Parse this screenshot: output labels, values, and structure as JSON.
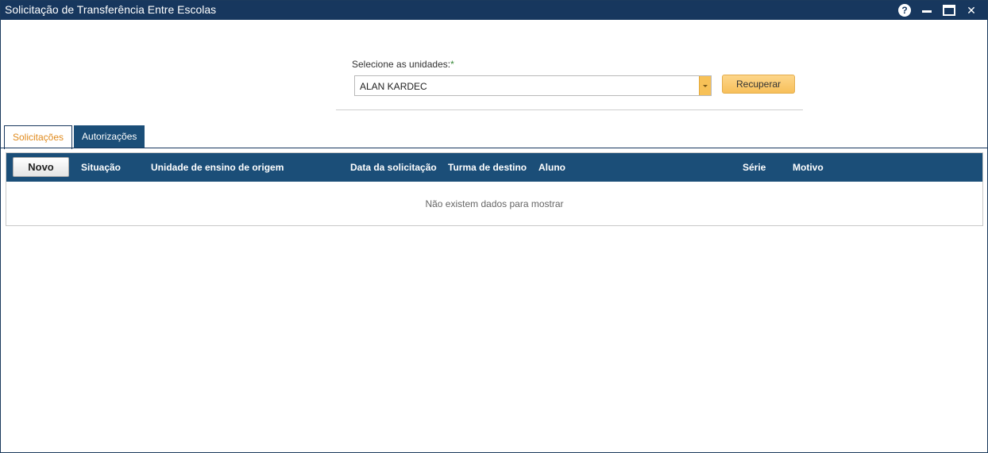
{
  "window": {
    "title": "Solicitação de Transferência Entre Escolas",
    "controls": {
      "help_glyph": "?",
      "help_icon": "help-icon",
      "minimize_icon": "minimize-icon",
      "maximize_icon": "maximize-icon",
      "close_icon": "close-icon",
      "close_glyph": "✕"
    }
  },
  "filter": {
    "label": "Selecione as unidades:",
    "required_mark": "*",
    "selected_unit": "ALAN KARDEC",
    "recuperar_label": "Recuperar"
  },
  "tabs": [
    {
      "label": "Solicitações",
      "active": true
    },
    {
      "label": "Autorizações",
      "active": false
    }
  ],
  "grid": {
    "new_button_label": "Novo",
    "columns": [
      "Situação",
      "Unidade de ensino de origem",
      "Data da solicitação",
      "Turma de destino",
      "Aluno",
      "Série",
      "Motivo"
    ],
    "empty_message": "Não existem dados para mostrar"
  },
  "colors": {
    "titlebar": "#17375e",
    "grid_header": "#1b4e78",
    "accent_button": "#f7c05a",
    "active_tab_text": "#e08a1c"
  }
}
